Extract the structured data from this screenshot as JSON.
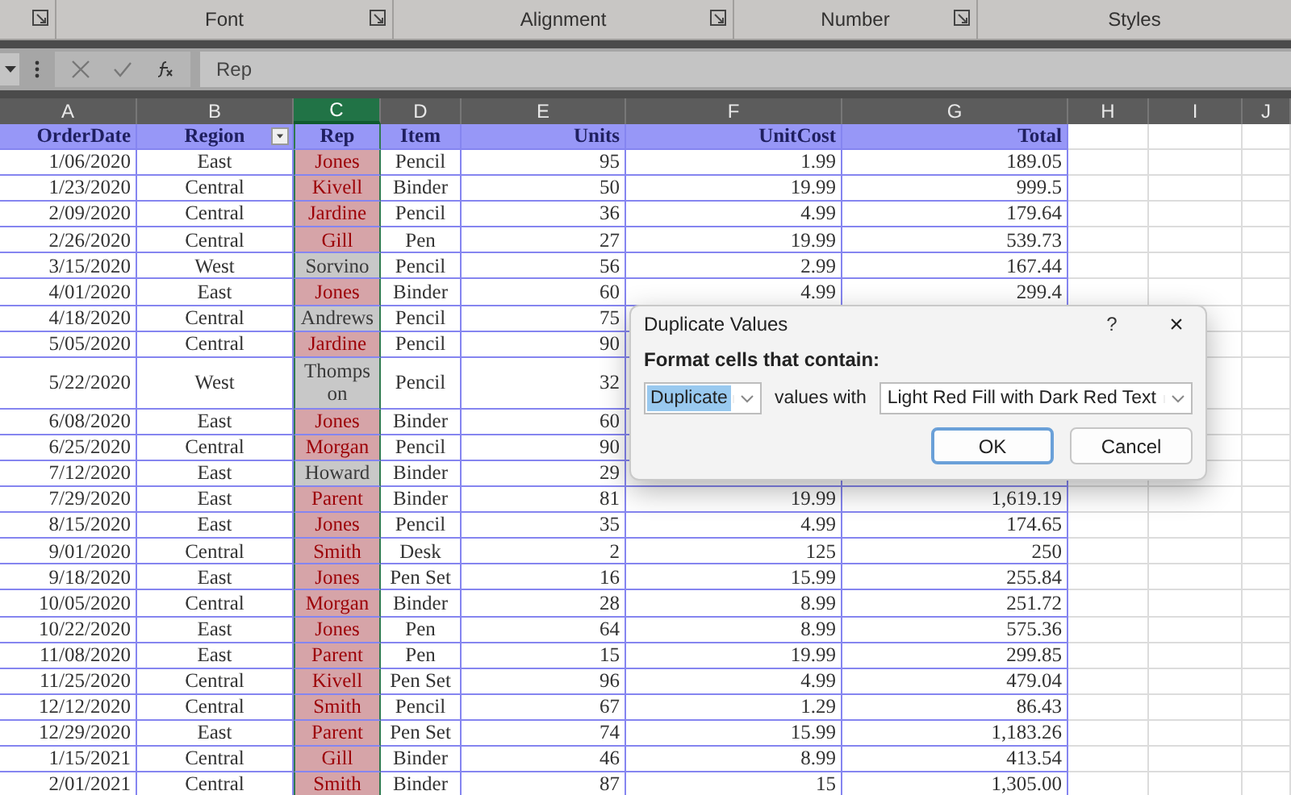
{
  "ribbon": {
    "groups": [
      {
        "launcher": true
      },
      {
        "label": "Font",
        "launcher": true
      },
      {
        "label": "Alignment",
        "launcher": true
      },
      {
        "label": "Number",
        "launcher": true
      },
      {
        "label": "Styles",
        "launcher": false
      }
    ]
  },
  "formula_bar": {
    "cell_value": "Rep"
  },
  "column_letters": [
    {
      "label": "A",
      "selected": false
    },
    {
      "label": "B",
      "selected": false
    },
    {
      "label": "C",
      "selected": true
    },
    {
      "label": "D",
      "selected": false
    },
    {
      "label": "E",
      "selected": false
    },
    {
      "label": "F",
      "selected": false
    },
    {
      "label": "G",
      "selected": false
    },
    {
      "label": "H",
      "selected": false
    },
    {
      "label": "I",
      "selected": false
    },
    {
      "label": "J",
      "selected": false
    }
  ],
  "table": {
    "columns": [
      {
        "label": "OrderDate",
        "filter": false
      },
      {
        "label": "Region",
        "filter": true
      },
      {
        "label": "Rep",
        "filter": false
      },
      {
        "label": "Item",
        "filter": false
      },
      {
        "label": "Units",
        "filter": false
      },
      {
        "label": "UnitCost",
        "filter": false
      },
      {
        "label": "Total",
        "filter": false
      }
    ],
    "rows": [
      {
        "order_date": "1/06/2020",
        "region": "East",
        "rep": "Jones",
        "item": "Pencil",
        "units": "95",
        "unit_cost": "1.99",
        "total": "189.05",
        "duplicate": true
      },
      {
        "order_date": "1/23/2020",
        "region": "Central",
        "rep": "Kivell",
        "item": "Binder",
        "units": "50",
        "unit_cost": "19.99",
        "total": "999.5",
        "duplicate": true
      },
      {
        "order_date": "2/09/2020",
        "region": "Central",
        "rep": "Jardine",
        "item": "Pencil",
        "units": "36",
        "unit_cost": "4.99",
        "total": "179.64",
        "duplicate": true
      },
      {
        "order_date": "2/26/2020",
        "region": "Central",
        "rep": "Gill",
        "item": "Pen",
        "units": "27",
        "unit_cost": "19.99",
        "total": "539.73",
        "duplicate": true
      },
      {
        "order_date": "3/15/2020",
        "region": "West",
        "rep": "Sorvino",
        "item": "Pencil",
        "units": "56",
        "unit_cost": "2.99",
        "total": "167.44",
        "duplicate": false
      },
      {
        "order_date": "4/01/2020",
        "region": "East",
        "rep": "Jones",
        "item": "Binder",
        "units": "60",
        "unit_cost": "4.99",
        "total": "299.4",
        "duplicate": true
      },
      {
        "order_date": "4/18/2020",
        "region": "Central",
        "rep": "Andrews",
        "item": "Pencil",
        "units": "75",
        "duplicate": false
      },
      {
        "order_date": "5/05/2020",
        "region": "Central",
        "rep": "Jardine",
        "item": "Pencil",
        "units": "90",
        "duplicate": true
      },
      {
        "order_date": "5/22/2020",
        "region": "West",
        "rep": "Thompson",
        "item": "Pencil",
        "units": "32",
        "duplicate": false
      },
      {
        "order_date": "6/08/2020",
        "region": "East",
        "rep": "Jones",
        "item": "Binder",
        "units": "60",
        "duplicate": true
      },
      {
        "order_date": "6/25/2020",
        "region": "Central",
        "rep": "Morgan",
        "item": "Pencil",
        "units": "90",
        "duplicate": true
      },
      {
        "order_date": "7/12/2020",
        "region": "East",
        "rep": "Howard",
        "item": "Binder",
        "units": "29",
        "duplicate": false
      },
      {
        "order_date": "7/29/2020",
        "region": "East",
        "rep": "Parent",
        "item": "Binder",
        "units": "81",
        "unit_cost": "19.99",
        "total": "1,619.19",
        "duplicate": true
      },
      {
        "order_date": "8/15/2020",
        "region": "East",
        "rep": "Jones",
        "item": "Pencil",
        "units": "35",
        "unit_cost": "4.99",
        "total": "174.65",
        "duplicate": true
      },
      {
        "order_date": "9/01/2020",
        "region": "Central",
        "rep": "Smith",
        "item": "Desk",
        "units": "2",
        "unit_cost": "125",
        "total": "250",
        "duplicate": true
      },
      {
        "order_date": "9/18/2020",
        "region": "East",
        "rep": "Jones",
        "item": "Pen Set",
        "units": "16",
        "unit_cost": "15.99",
        "total": "255.84",
        "duplicate": true
      },
      {
        "order_date": "10/05/2020",
        "region": "Central",
        "rep": "Morgan",
        "item": "Binder",
        "units": "28",
        "unit_cost": "8.99",
        "total": "251.72",
        "duplicate": true
      },
      {
        "order_date": "10/22/2020",
        "region": "East",
        "rep": "Jones",
        "item": "Pen",
        "units": "64",
        "unit_cost": "8.99",
        "total": "575.36",
        "duplicate": true
      },
      {
        "order_date": "11/08/2020",
        "region": "East",
        "rep": "Parent",
        "item": "Pen",
        "units": "15",
        "unit_cost": "19.99",
        "total": "299.85",
        "duplicate": true
      },
      {
        "order_date": "11/25/2020",
        "region": "Central",
        "rep": "Kivell",
        "item": "Pen Set",
        "units": "96",
        "unit_cost": "4.99",
        "total": "479.04",
        "duplicate": true
      },
      {
        "order_date": "12/12/2020",
        "region": "Central",
        "rep": "Smith",
        "item": "Pencil",
        "units": "67",
        "unit_cost": "1.29",
        "total": "86.43",
        "duplicate": true
      },
      {
        "order_date": "12/29/2020",
        "region": "East",
        "rep": "Parent",
        "item": "Pen Set",
        "units": "74",
        "unit_cost": "15.99",
        "total": "1,183.26",
        "duplicate": true
      },
      {
        "order_date": "1/15/2021",
        "region": "Central",
        "rep": "Gill",
        "item": "Binder",
        "units": "46",
        "unit_cost": "8.99",
        "total": "413.54",
        "duplicate": true
      },
      {
        "order_date": "2/01/2021",
        "region": "Central",
        "rep": "Smith",
        "item": "Binder",
        "units": "87",
        "unit_cost": "15",
        "total": "1,305.00",
        "duplicate": true
      }
    ]
  },
  "dialog": {
    "title": "Duplicate Values",
    "help": "?",
    "close": "×",
    "prompt": "Format cells that contain:",
    "rule_value": "Duplicate",
    "middle_text": "values with",
    "format_value": "Light Red Fill with Dark Red Text",
    "buttons": [
      {
        "label": "OK",
        "focused": true
      },
      {
        "label": "Cancel",
        "focused": false
      }
    ]
  }
}
